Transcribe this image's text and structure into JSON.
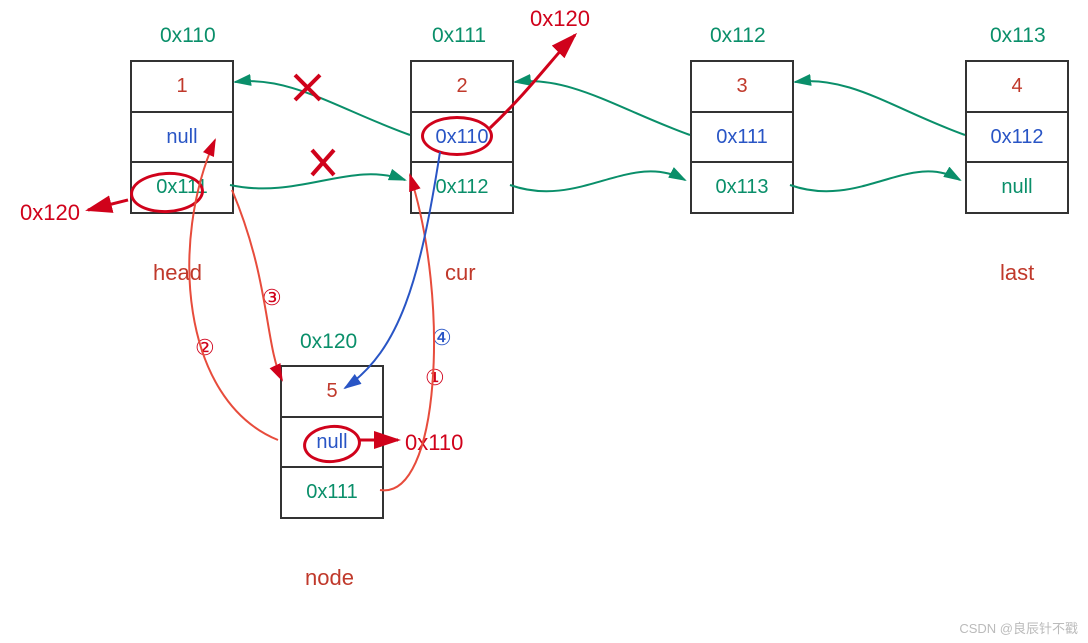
{
  "nodes": {
    "head": {
      "addr": "0x110",
      "val": "1",
      "prev": "null",
      "next": "0x111",
      "label": "head"
    },
    "cur": {
      "addr": "0x111",
      "val": "2",
      "prev": "0x110",
      "next": "0x112",
      "label": "cur"
    },
    "n3": {
      "addr": "0x112",
      "val": "3",
      "prev": "0x111",
      "next": "0x113",
      "label": ""
    },
    "last": {
      "addr": "0x113",
      "val": "4",
      "prev": "0x112",
      "next": "null",
      "label": "last"
    },
    "new": {
      "addr": "0x120",
      "val": "5",
      "prev": "null",
      "next": "0x111",
      "label": "node"
    }
  },
  "annotations": {
    "head_next_new": "0x120",
    "cur_prev_new": "0x120",
    "node_prev_new": "0x110",
    "step1": "①",
    "step2": "②",
    "step3": "③",
    "step4": "④"
  },
  "colors": {
    "value": "#c0392b",
    "prev": "#2955c5",
    "next": "#0a8f6a",
    "markRed": "#d0021b"
  },
  "watermark": "CSDN @良辰针不戳"
}
